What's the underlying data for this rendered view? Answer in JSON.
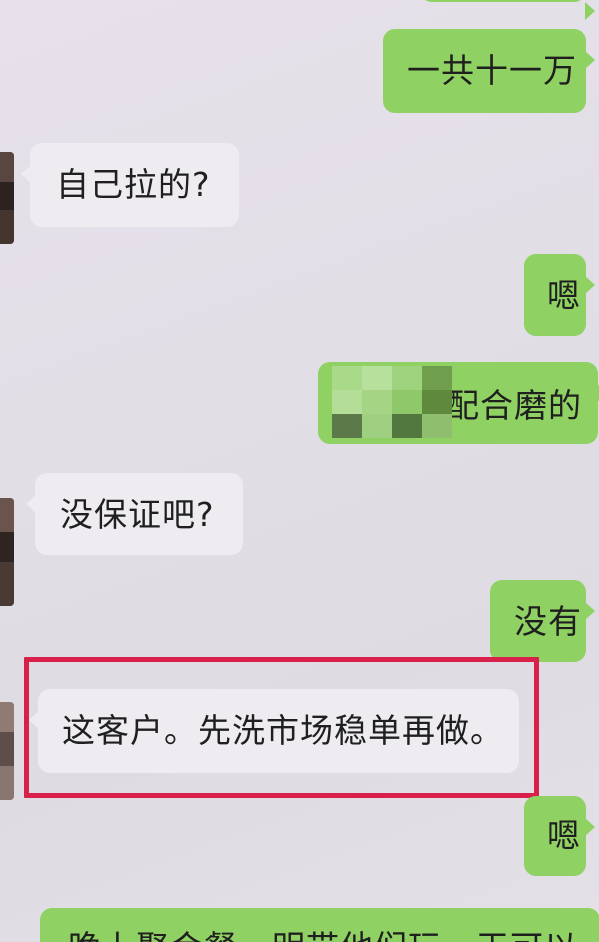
{
  "chat": {
    "messages": [
      {
        "side": "out",
        "text": "一共十一万"
      },
      {
        "side": "in",
        "text": "自己拉的?"
      },
      {
        "side": "out",
        "text": "嗯"
      },
      {
        "side": "out",
        "text": "配合磨的",
        "has_redacted_prefix": true
      },
      {
        "side": "in",
        "text": "没保证吧?"
      },
      {
        "side": "out",
        "text": "没有"
      },
      {
        "side": "in",
        "text": "这客户。先洗市场稳单再做。",
        "highlighted": true
      },
      {
        "side": "out",
        "text": "嗯"
      },
      {
        "side": "out",
        "text": "晚上聚会餐，明带他们玩一天可以",
        "truncated": true
      }
    ]
  },
  "colors": {
    "outgoing_bubble": "#8fd162",
    "incoming_bubble": "#efecf1",
    "highlight_border": "#d8204a",
    "background": "#e2dee6"
  }
}
